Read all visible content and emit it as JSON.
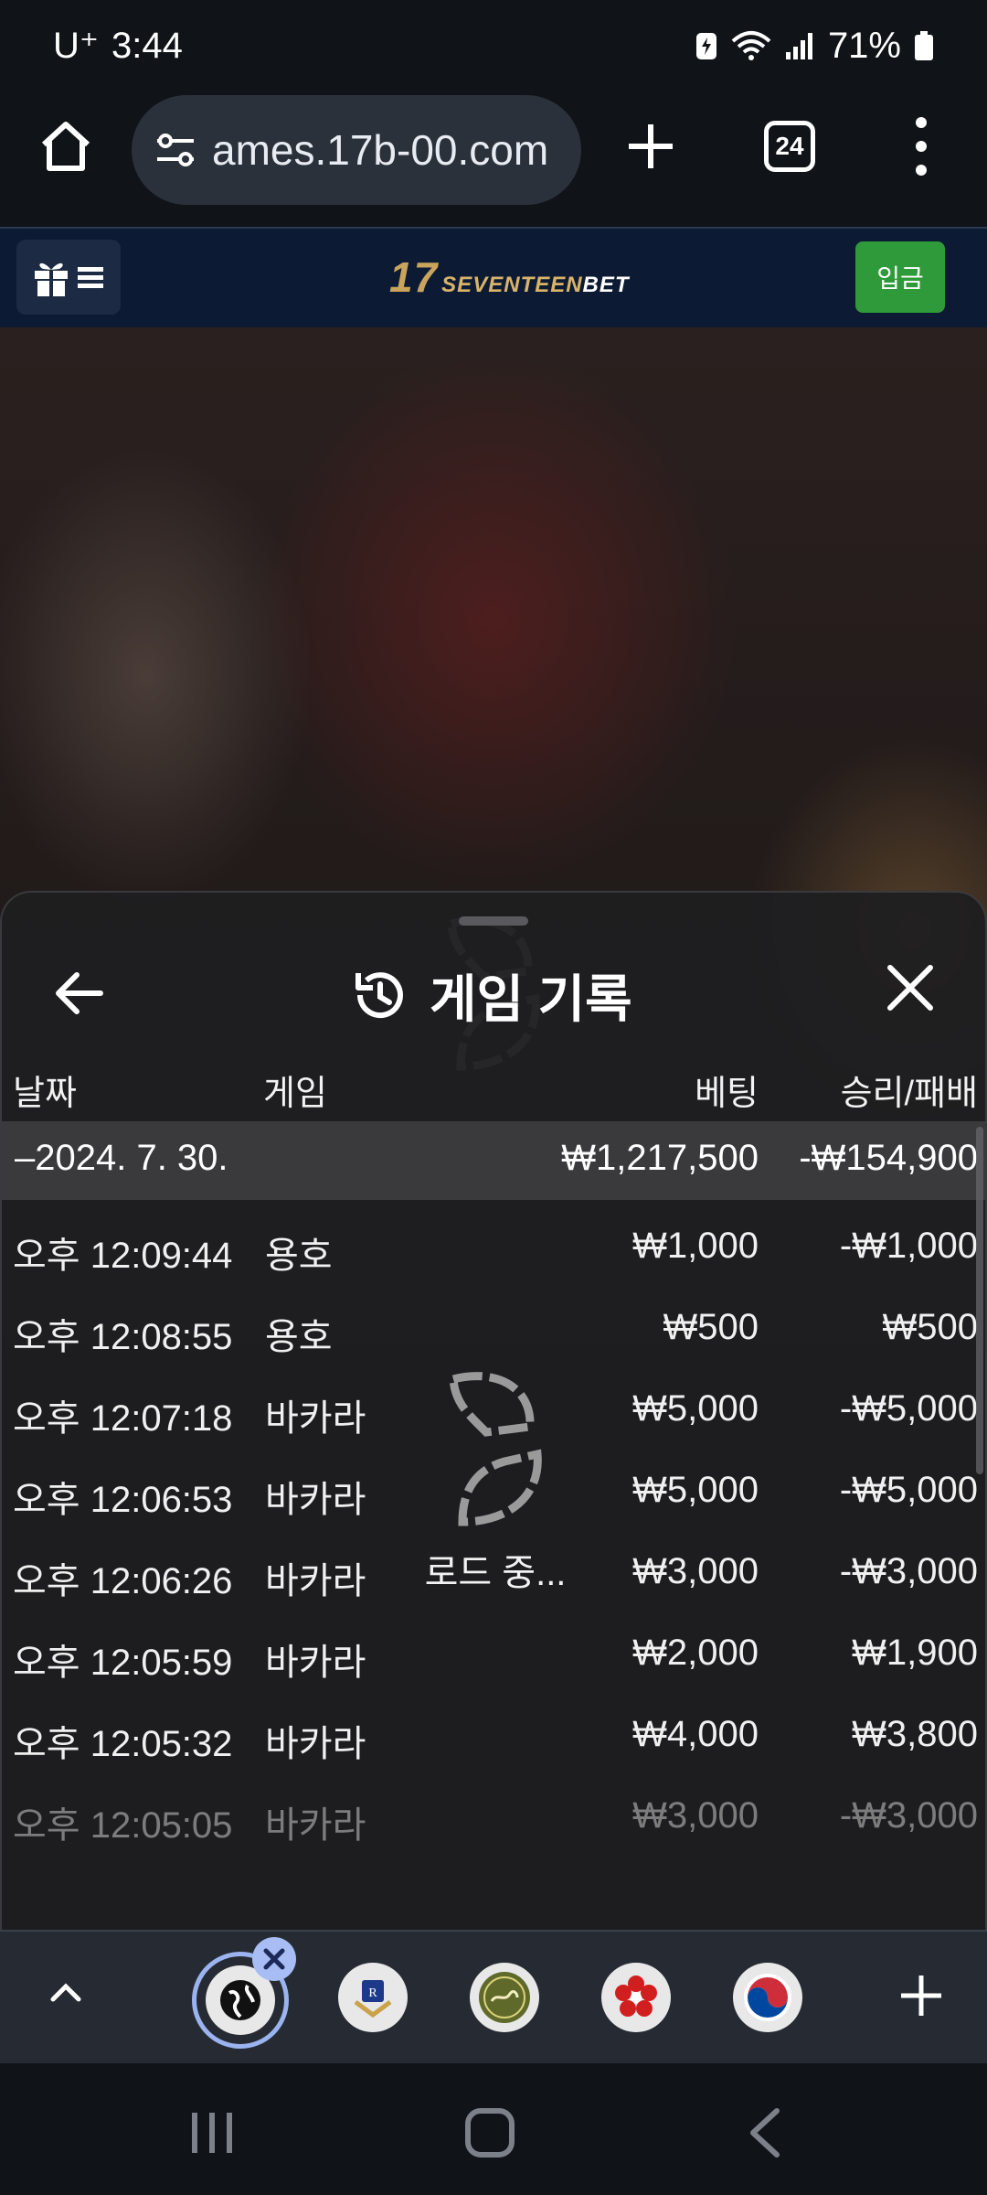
{
  "status_bar": {
    "carrier": "U⁺",
    "time": "3:44",
    "battery": "71%"
  },
  "browser": {
    "url": "ames.17b-00.com",
    "tab_count": "24"
  },
  "site_header": {
    "logo_number": "17",
    "logo_brand": "SEVENTEEN",
    "logo_bet": "BET",
    "deposit_label": "입금",
    "deposit_color": "#2f9a3a"
  },
  "sheet": {
    "title": "게임 기록",
    "columns": {
      "date": "날짜",
      "game": "게임",
      "bet": "베팅",
      "win_loss": "승리/패배"
    },
    "group": {
      "date": "–2024. 7. 30.",
      "bet": "₩1,217,500",
      "win_loss": "-₩154,900"
    },
    "rows": [
      {
        "time": "오후 12:09:44",
        "game": "용호",
        "bet": "₩1,000",
        "win_loss": "-₩1,000"
      },
      {
        "time": "오후 12:08:55",
        "game": "용호",
        "bet": "₩500",
        "win_loss": "₩500"
      },
      {
        "time": "오후 12:07:18",
        "game": "바카라",
        "bet": "₩5,000",
        "win_loss": "-₩5,000"
      },
      {
        "time": "오후 12:06:53",
        "game": "바카라",
        "bet": "₩5,000",
        "win_loss": "-₩5,000"
      },
      {
        "time": "오후 12:06:26",
        "game": "바카라",
        "bet": "₩3,000",
        "win_loss": "-₩3,000"
      },
      {
        "time": "오후 12:05:59",
        "game": "바카라",
        "bet": "₩2,000",
        "win_loss": "₩1,900"
      },
      {
        "time": "오후 12:05:32",
        "game": "바카라",
        "bet": "₩4,000",
        "win_loss": "₩3,800"
      },
      {
        "time": "오후 12:05:05",
        "game": "바카라",
        "bet": "₩3,000",
        "win_loss": "-₩3,000"
      }
    ],
    "loading_text": "로드 중..."
  },
  "icons": {
    "home": "home-icon",
    "site_settings": "tune-icon",
    "new_tab": "plus-icon",
    "menu": "kebab-icon",
    "gift": "gift-icon",
    "hamburger": "hamburger-icon",
    "back": "arrow-left-icon",
    "history": "history-icon",
    "close": "close-icon"
  }
}
